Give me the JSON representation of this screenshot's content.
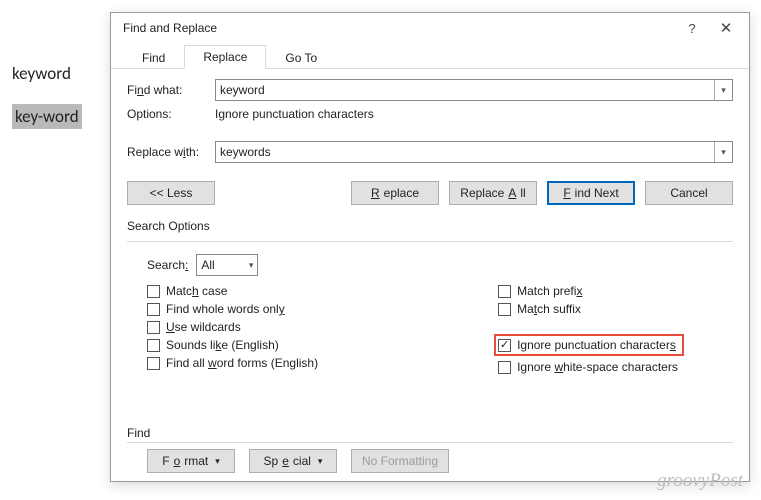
{
  "doc": {
    "word1": "keyword",
    "word2": "key-word"
  },
  "dialog": {
    "title": "Find and Replace",
    "tabs": {
      "find": "Find",
      "replace": "Replace",
      "goto": "Go To"
    },
    "find_what_label": "Find what:",
    "find_what_value": "keyword",
    "options_label": "Options:",
    "options_text": "Ignore punctuation characters",
    "replace_with_label": "Replace with:",
    "replace_with_value": "keywords",
    "buttons": {
      "less": "<< Less",
      "replace": "Replace",
      "replace_all": "Replace All",
      "find_next": "Find Next",
      "cancel": "Cancel"
    },
    "search_options_label": "Search Options",
    "search_label": "Search:",
    "search_value": "All",
    "checks_left": {
      "match_case": "Match case",
      "whole_words": "Find whole words only",
      "wildcards": "Use wildcards",
      "sounds_like": "Sounds like (English)",
      "word_forms": "Find all word forms (English)"
    },
    "checks_right": {
      "match_prefix": "Match prefix",
      "match_suffix": "Match suffix",
      "ignore_punct": "Ignore punctuation characters",
      "ignore_ws": "Ignore white-space characters"
    },
    "find_group": "Find",
    "bottom_buttons": {
      "format": "Format",
      "special": "Special",
      "no_formatting": "No Formatting"
    }
  },
  "watermark": "groovyPost"
}
